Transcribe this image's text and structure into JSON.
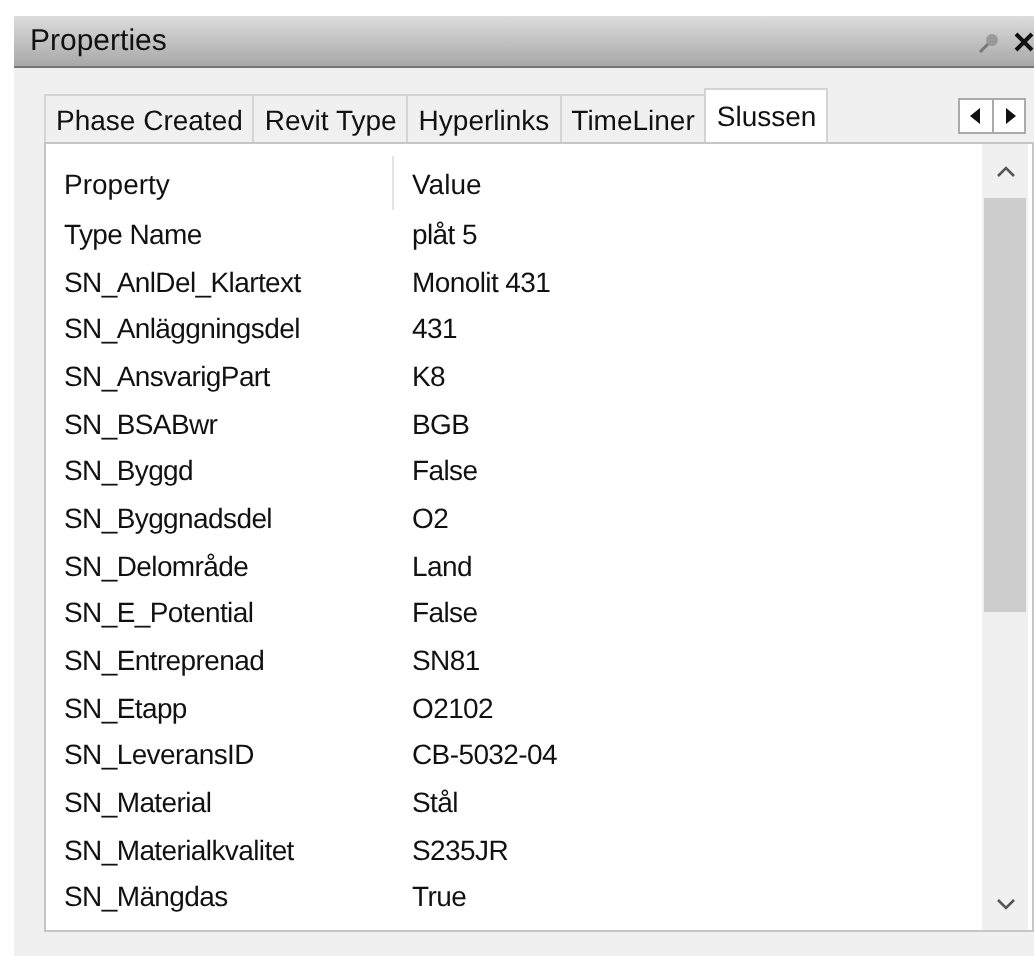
{
  "window": {
    "title": "Properties"
  },
  "tabs": [
    {
      "label": "Phase Created",
      "selected": false
    },
    {
      "label": "Revit Type",
      "selected": false
    },
    {
      "label": "Hyperlinks",
      "selected": false
    },
    {
      "label": "TimeLiner",
      "selected": false
    },
    {
      "label": "Slussen",
      "selected": true
    }
  ],
  "table": {
    "columns": [
      "Property",
      "Value"
    ],
    "rows": [
      [
        "Type Name",
        "plåt 5"
      ],
      [
        "SN_AnlDel_Klartext",
        "Monolit 431"
      ],
      [
        "SN_Anläggningsdel",
        "431"
      ],
      [
        "SN_AnsvarigPart",
        "K8"
      ],
      [
        "SN_BSABwr",
        "BGB"
      ],
      [
        "SN_Byggd",
        "False"
      ],
      [
        "SN_Byggnadsdel",
        "O2"
      ],
      [
        "SN_Delområde",
        "Land"
      ],
      [
        "SN_E_Potential",
        "False"
      ],
      [
        "SN_Entreprenad",
        "SN81"
      ],
      [
        "SN_Etapp",
        "O2102"
      ],
      [
        "SN_LeveransID",
        "CB-5032-04"
      ],
      [
        "SN_Material",
        "Stål"
      ],
      [
        "SN_Materialkvalitet",
        "S235JR"
      ],
      [
        "SN_Mängdas",
        "True"
      ]
    ]
  }
}
